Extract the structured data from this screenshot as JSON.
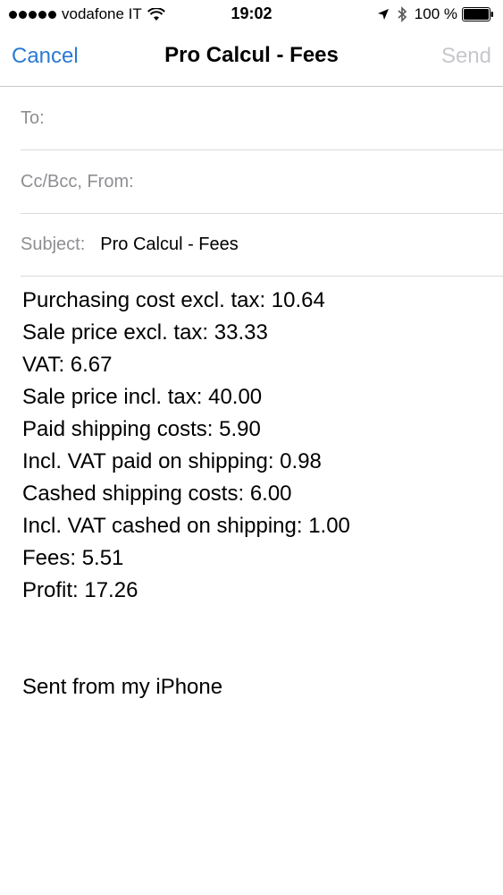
{
  "status_bar": {
    "carrier": "vodafone IT",
    "time": "19:02",
    "battery": "100 %"
  },
  "nav": {
    "cancel_label": "Cancel",
    "title": "Pro Calcul - Fees",
    "send_label": "Send"
  },
  "fields": {
    "to_label": "To:",
    "cc_label": "Cc/Bcc, From:",
    "subject_label": "Subject:",
    "subject_value": "Pro Calcul - Fees"
  },
  "body": {
    "lines": [
      "Purchasing cost excl. tax: 10.64",
      "Sale price excl. tax: 33.33",
      "VAT: 6.67",
      "Sale price incl. tax: 40.00",
      "Paid shipping costs: 5.90",
      "Incl. VAT paid on shipping: 0.98",
      "Cashed shipping costs: 6.00",
      "Incl. VAT cashed on shipping: 1.00",
      "Fees: 5.51",
      "Profit: 17.26"
    ],
    "signature": "Sent from my iPhone"
  },
  "colors": {
    "accent": "#2a7ad1",
    "disabled": "#c7c7cc",
    "label_gray": "#8e8e93",
    "separator": "#c8c7cc"
  },
  "icons": [
    "signal-dots-icon",
    "wifi-icon",
    "location-arrow-icon",
    "bluetooth-icon",
    "battery-icon"
  ]
}
